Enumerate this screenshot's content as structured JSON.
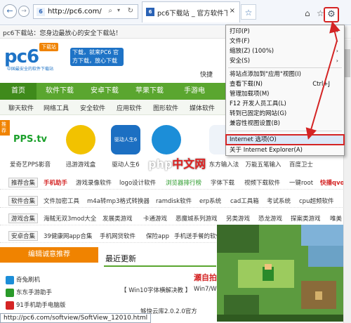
{
  "browser": {
    "back": "←",
    "forward": "→",
    "address": {
      "icon": "6",
      "url": "http://pc6.com/",
      "search_glyph": "⌕",
      "dropdown_glyph": "▾",
      "refresh_glyph": "↻"
    },
    "tab": {
      "favicon": "6",
      "title": "pc6下载站 _ 官方软件下载...",
      "close": "×"
    },
    "new_tab_glyph": "☆",
    "home_glyph": "⌂",
    "favorites_glyph": "☆",
    "gear_glyph": "⚙"
  },
  "page": {
    "notice": "pc6下载站：您身边最放心的安全下载站！",
    "logo": {
      "text": "pc6",
      "badge": "下载站",
      "sub": "中国最安全的软件下载站"
    },
    "slogan": "下载，就来PC6 官方下载，放心下载",
    "quick": "快捷",
    "mainnav": [
      "首页",
      "软件下载",
      "安卓下载",
      "苹果下载",
      "手游电"
    ],
    "subnav": [
      "聊天软件",
      "网络工具",
      "安全软件",
      "应用软件",
      "图形软件",
      "媒体软件"
    ],
    "recommend_badge": "推荐",
    "apps": [
      {
        "label": "爱奇艺PPS影音",
        "color": "#1aa02a",
        "text": "PPS.tv"
      },
      {
        "label": "迅游游戏盒",
        "color": "#f2c200",
        "text": ""
      },
      {
        "label": "驱动人生6",
        "color": "#1c6fc2",
        "text": "驱动人生6"
      },
      {
        "label": "",
        "color": "#1c8ed8",
        "text": ""
      },
      {
        "label": "东方输入法",
        "color": "#ffffff",
        "text": ""
      },
      {
        "label": "万能五笔输入",
        "color": "#ffffff",
        "text": ""
      },
      {
        "label": "百度卫士",
        "color": "#ffffff",
        "text": ""
      }
    ],
    "tagrows": [
      {
        "head": "推荐合集",
        "items": [
          {
            "t": "手机助手",
            "style": "red"
          },
          {
            "t": "游戏录像软件",
            "style": ""
          },
          {
            "t": "logo设计软件",
            "style": ""
          },
          {
            "t": "浏览器排行榜",
            "style": "green"
          },
          {
            "t": "字体下载",
            "style": ""
          },
          {
            "t": "视频下载软件",
            "style": ""
          },
          {
            "t": "一键root",
            "style": ""
          },
          {
            "t": "快播qvo",
            "style": "red"
          }
        ]
      },
      {
        "head": "软件合集",
        "items": [
          {
            "t": "文件加密工具",
            "style": ""
          },
          {
            "t": "m4a转mp3格式转换器",
            "style": ""
          },
          {
            "t": "ramdisk软件",
            "style": ""
          },
          {
            "t": "erp系统",
            "style": ""
          },
          {
            "t": "cad工具箱",
            "style": ""
          },
          {
            "t": "考试系统",
            "style": ""
          },
          {
            "t": "cpu超频软件",
            "style": ""
          }
        ]
      },
      {
        "head": "游戏合集",
        "items": [
          {
            "t": "海贼无双3mod大全",
            "style": ""
          },
          {
            "t": "发展类游戏",
            "style": ""
          },
          {
            "t": "卡通游戏",
            "style": ""
          },
          {
            "t": "恶魔城系列游戏",
            "style": ""
          },
          {
            "t": "另类游戏",
            "style": ""
          },
          {
            "t": "恐龙游戏",
            "style": ""
          },
          {
            "t": "探案类游戏",
            "style": ""
          },
          {
            "t": "唯美",
            "style": ""
          }
        ]
      },
      {
        "head": "安卓合集",
        "items": [
          {
            "t": "39健康网app合集",
            "style": ""
          },
          {
            "t": "手机网贷软件",
            "style": ""
          },
          {
            "t": "保险app",
            "style": ""
          },
          {
            "t": "手机送手餐的软件",
            "style": ""
          },
          {
            "t": "",
            "style": ""
          }
        ]
      }
    ],
    "leftbox": {
      "head": "编辑诚意推荐",
      "rows": [
        {
          "t": "奇兔刷机",
          "color": "#1c8ed8"
        },
        {
          "t": "东东手游助手",
          "color": "#2a9a2a"
        },
        {
          "t": "91手机助手电脑版",
          "color": "#d42424"
        }
      ]
    },
    "latest": "最近更新",
    "headline": "瀬自拍",
    "win10": "【 Win10字体横解决教 】",
    "win7": "Win7/Wi",
    "lazy": "够快云库2.0.2.0官方",
    "watermark_a": "php",
    "watermark_b": "中文网",
    "status_url": "http://pc6.com/softview/SoftView_12010.html"
  },
  "menu": {
    "items": [
      {
        "label": "打印(P)",
        "arrow": "›",
        "shortcut": ""
      },
      {
        "label": "文件(F)",
        "arrow": "›",
        "shortcut": ""
      },
      {
        "label": "缩放(Z) (100%)",
        "arrow": "›",
        "shortcut": ""
      },
      {
        "label": "安全(S)",
        "arrow": "›",
        "shortcut": ""
      },
      {
        "label": "将站点添加到\"应用\"视图(I)",
        "arrow": "",
        "shortcut": ""
      },
      {
        "label": "查看下载(N)",
        "arrow": "",
        "shortcut": "Ctrl+J"
      },
      {
        "label": "管理加载项(M)",
        "arrow": "",
        "shortcut": ""
      },
      {
        "label": "F12 开发人员工具(L)",
        "arrow": "",
        "shortcut": ""
      },
      {
        "label": "转到已固定的网站(G)",
        "arrow": "",
        "shortcut": ""
      },
      {
        "label": "兼容性视图设置(B)",
        "arrow": "",
        "shortcut": ""
      },
      {
        "label": "Internet 选项(O)",
        "arrow": "",
        "shortcut": ""
      },
      {
        "label": "关于 Internet Explorer(A)",
        "arrow": "",
        "shortcut": ""
      }
    ]
  },
  "colors": {
    "accent_red": "#d42424",
    "nav_green": "#5aa62f",
    "ie_blue": "#1e73c6",
    "orange": "#f08300"
  }
}
